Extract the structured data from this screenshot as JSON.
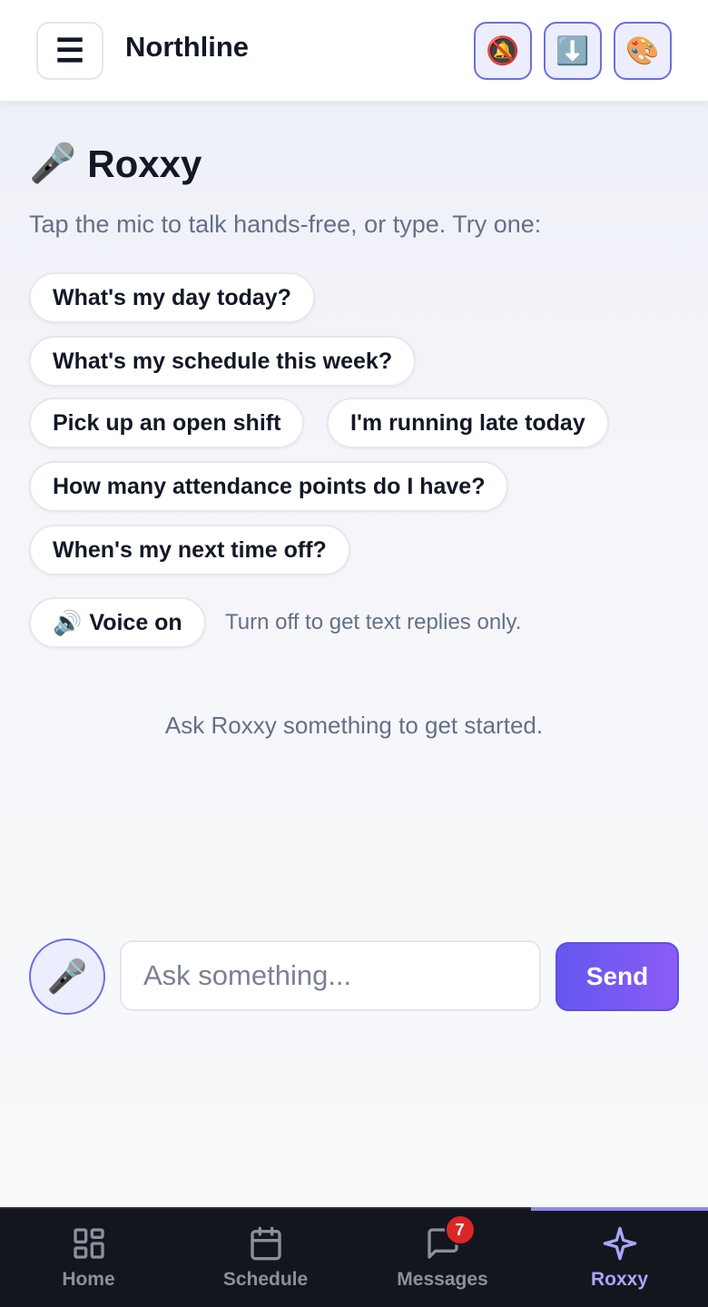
{
  "header": {
    "menu_icon": "☰",
    "title": "Northline",
    "buttons": [
      {
        "name": "mute-notifications",
        "icon": "🔕"
      },
      {
        "name": "download",
        "icon": "⬇️"
      },
      {
        "name": "theme",
        "icon": "🎨"
      }
    ]
  },
  "assistant": {
    "title_icon": "🎤",
    "title": "Roxxy",
    "subtitle": "Tap the mic to talk hands-free, or type. Try one:",
    "suggestions": [
      "What's my day today?",
      "What's my schedule this week?",
      "Pick up an open shift",
      "I'm running late today",
      "How many attendance points do I have?",
      "When's my next time off?"
    ],
    "voice": {
      "icon": "🔊",
      "label": "Voice on",
      "hint": "Turn off to get text replies only."
    },
    "empty_state": "Ask Roxxy something to get started."
  },
  "composer": {
    "mic_icon": "🎤",
    "placeholder": "Ask something...",
    "value": "",
    "send_label": "Send"
  },
  "nav": {
    "items": [
      {
        "label": "Home",
        "icon": "grid-icon",
        "active": false
      },
      {
        "label": "Schedule",
        "icon": "calendar-icon",
        "active": false
      },
      {
        "label": "Messages",
        "icon": "chat-icon",
        "active": false,
        "badge": "7"
      },
      {
        "label": "Roxxy",
        "icon": "sparkle-icon",
        "active": true
      }
    ]
  },
  "colors": {
    "accent": "#6457f0",
    "accent_light": "#eceefe",
    "badge": "#dc2626",
    "nav_bg": "#14161e"
  }
}
